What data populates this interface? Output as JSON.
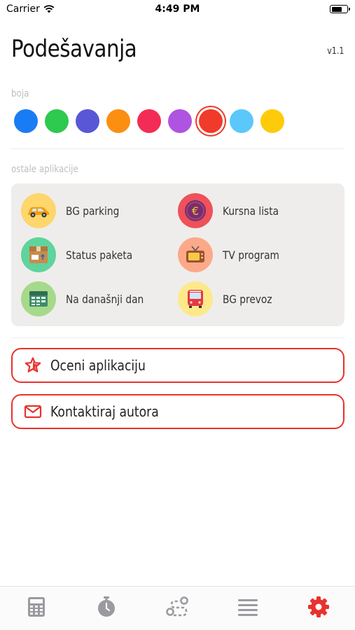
{
  "status_bar": {
    "carrier": "Carrier",
    "time": "4:49 PM",
    "battery_level": 0.75
  },
  "header": {
    "title": "Podešavanja",
    "version": "v1.1"
  },
  "colors_section": {
    "label": "boja",
    "swatches": [
      "#1a7cf5",
      "#2ec94f",
      "#5a57d6",
      "#fb8f12",
      "#f32c55",
      "#ae54e0",
      "#f03a2a",
      "#5ac8fa",
      "#fecb0a"
    ],
    "selected_index": 6
  },
  "apps_section": {
    "label": "ostale aplikacije",
    "apps": [
      {
        "label": "BG parking",
        "icon": "car-icon",
        "bg": "#fdd66c"
      },
      {
        "label": "Kursna lista",
        "icon": "euro-icon",
        "bg": "#ee5159"
      },
      {
        "label": "Status paketa",
        "icon": "package-icon",
        "bg": "#5fd49d"
      },
      {
        "label": "TV program",
        "icon": "tv-icon",
        "bg": "#fca98a"
      },
      {
        "label": "Na današnji dan",
        "icon": "calendar-icon",
        "bg": "#a6d98a"
      },
      {
        "label": "BG prevoz",
        "icon": "bus-icon",
        "bg": "#fde98a"
      }
    ]
  },
  "actions": {
    "rate_label": "Oceni aplikaciju",
    "contact_label": "Kontaktiraj autora",
    "accent": "#e8322d"
  },
  "tab_bar": {
    "tabs": [
      "calculator-icon",
      "stopwatch-icon",
      "route-icon",
      "list-icon",
      "settings-icon"
    ],
    "active_index": 4,
    "inactive_color": "#9a9aa0",
    "active_color": "#e8322d"
  }
}
